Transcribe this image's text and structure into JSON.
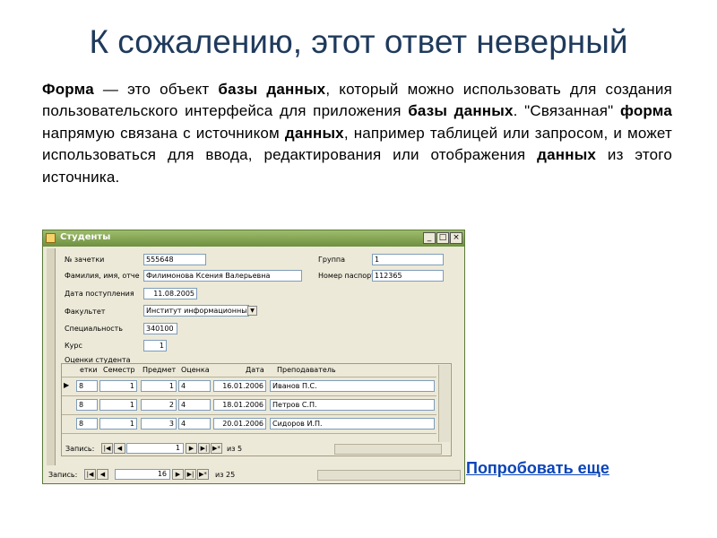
{
  "slide": {
    "title": "К сожалению, этот ответ неверный",
    "try_again": "Попробовать еще"
  },
  "paragraph": [
    {
      "t": "Форма",
      "b": true
    },
    {
      "t": " — это объект ",
      "b": false
    },
    {
      "t": "базы данных",
      "b": true
    },
    {
      "t": ", который можно использовать для создания пользовательского интерфейса для приложения ",
      "b": false
    },
    {
      "t": "базы данных",
      "b": true
    },
    {
      "t": ". \"Связанная\" ",
      "b": false
    },
    {
      "t": "форма",
      "b": true
    },
    {
      "t": " напрямую связана с источником ",
      "b": false
    },
    {
      "t": "данных",
      "b": true
    },
    {
      "t": ", например таблицей или запросом, и может использоваться для ввода, редактирования или отображения ",
      "b": false
    },
    {
      "t": "данных",
      "b": true
    },
    {
      "t": " из этого источника.",
      "b": false
    }
  ],
  "window": {
    "title": "Студенты",
    "buttons": {
      "minimize": "_",
      "maximize": "□",
      "close": "×"
    },
    "fields": {
      "record_book_label": "№ зачетки",
      "record_book_value": "555648",
      "group_label": "Группа",
      "group_value": "1",
      "name_label": "Фамилия, имя, отче",
      "name_value": "Филимонова Ксения Валерьевна",
      "passport_label": "Номер паспорта",
      "passport_value": "112365",
      "admission_label": "Дата поступления",
      "admission_value": "11.08.2005",
      "faculty_label": "Факультет",
      "faculty_value": "Институт информационны",
      "specialty_label": "Специальность",
      "specialty_value": "340100",
      "course_label": "Курс",
      "course_value": "1"
    },
    "grades": {
      "caption": "Оценки студента",
      "columns": [
        "етки",
        "Семестр",
        "Предмет",
        "Оценка",
        "Дата",
        "Преподаватель"
      ],
      "rows": [
        {
          "rb": "8",
          "sem": "1",
          "subj": "1",
          "grade": "4",
          "date": "16.01.2006",
          "teacher": "Иванов П.С."
        },
        {
          "rb": "8",
          "sem": "1",
          "subj": "2",
          "grade": "4",
          "date": "18.01.2006",
          "teacher": "Петров С.П."
        },
        {
          "rb": "8",
          "sem": "1",
          "subj": "3",
          "grade": "4",
          "date": "20.01.2006",
          "teacher": "Сидоров И.П."
        }
      ],
      "nav": {
        "label": "Запись:",
        "current": "1",
        "of": "из 5"
      }
    },
    "nav": {
      "label": "Запись:",
      "current": "16",
      "of": "из 25"
    }
  }
}
